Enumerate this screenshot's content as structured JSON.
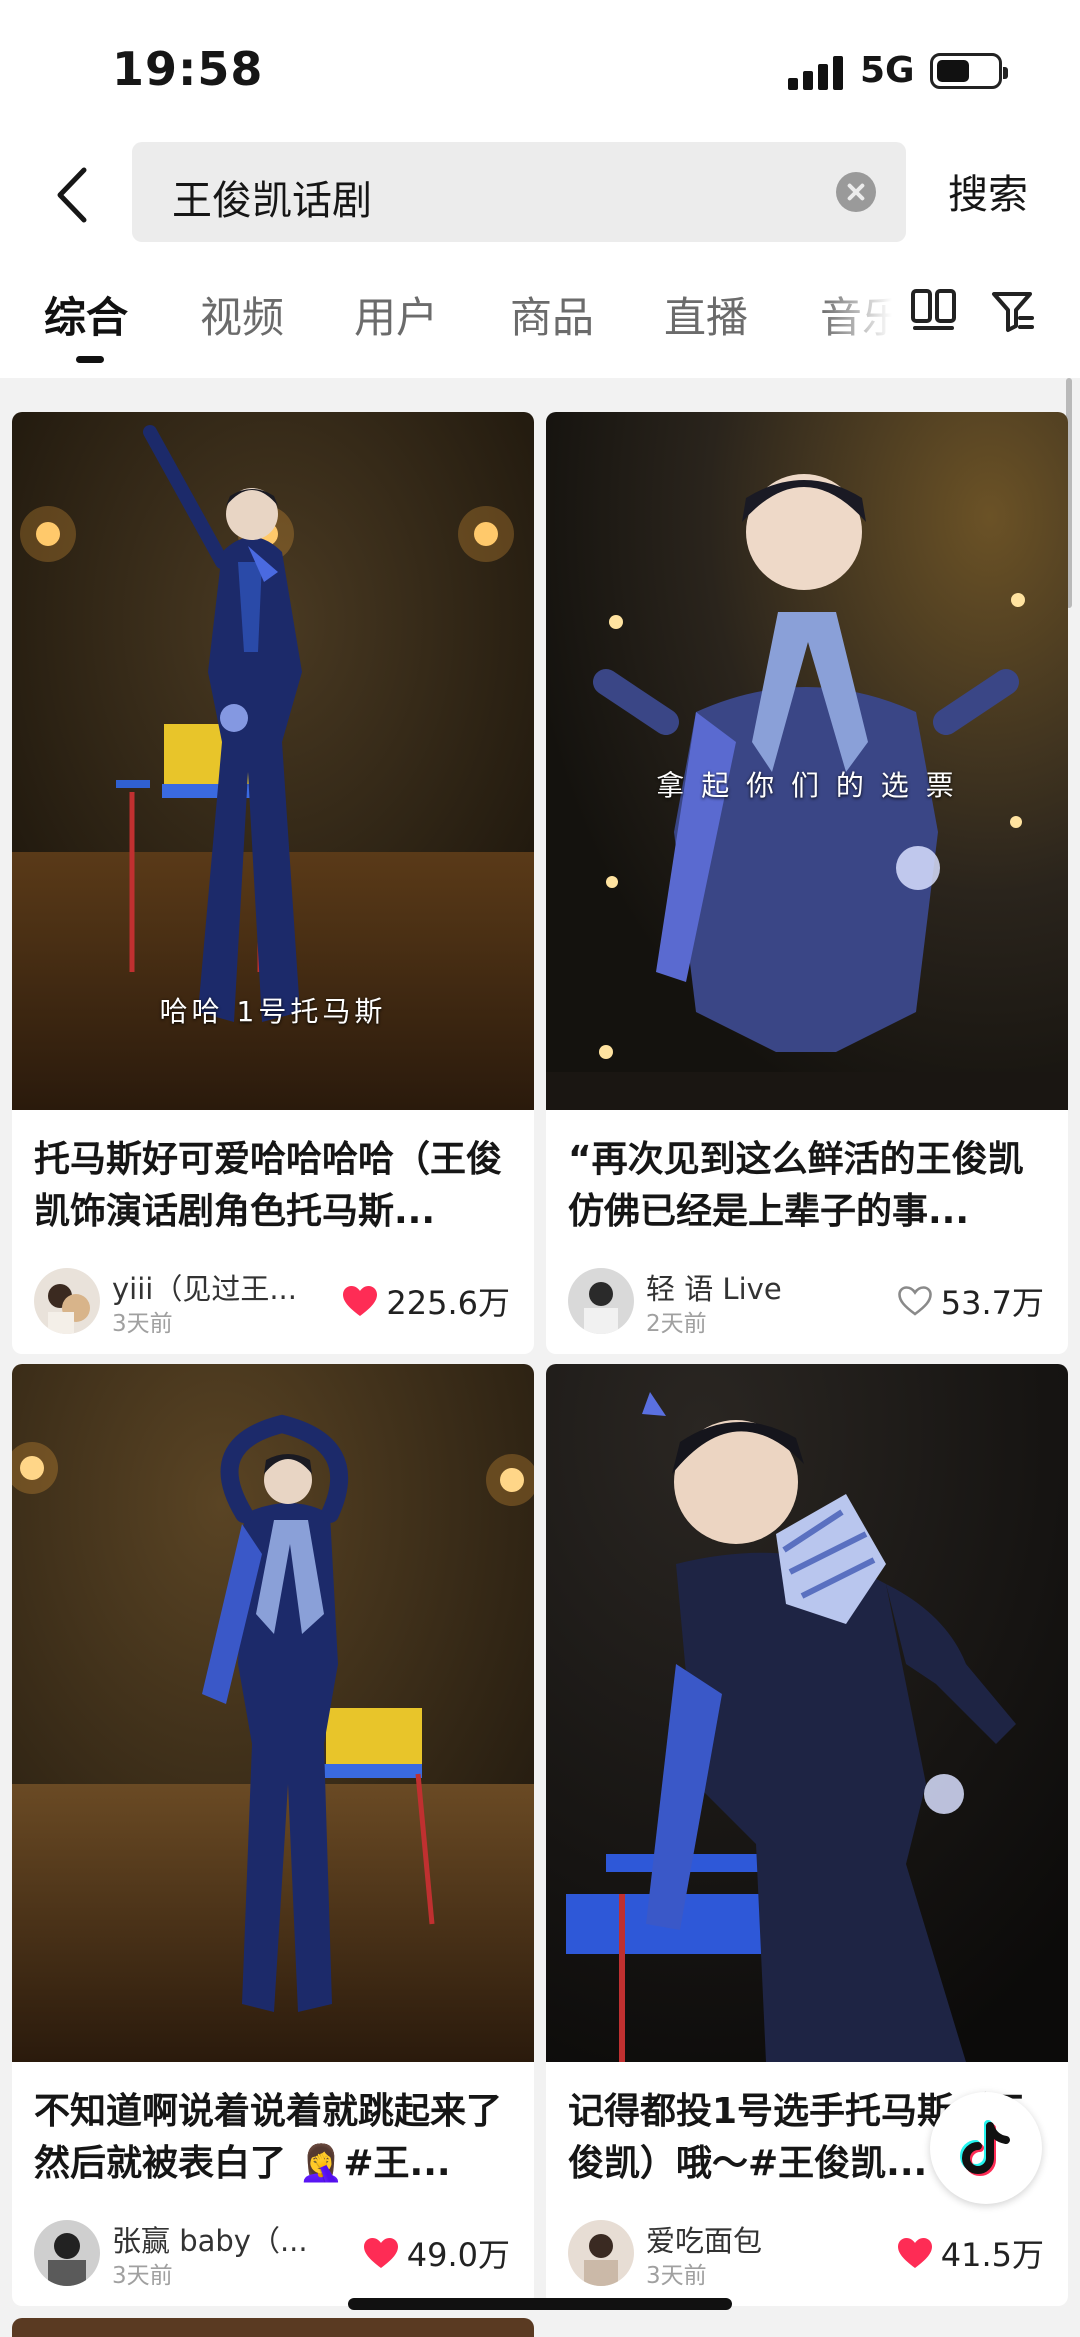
{
  "status_bar": {
    "time": "19:58",
    "network": "5G",
    "battery_level": 0.55
  },
  "search": {
    "query": "王俊凯话剧",
    "submit_label": "搜索"
  },
  "tabs": [
    {
      "label": "综合",
      "active": true
    },
    {
      "label": "视频",
      "active": false
    },
    {
      "label": "用户",
      "active": false
    },
    {
      "label": "商品",
      "active": false
    },
    {
      "label": "直播",
      "active": false
    },
    {
      "label": "音乐",
      "active": false
    }
  ],
  "icons": {
    "back": "chevron-left-icon",
    "clear": "clear-icon",
    "layout": "dual-column-layout-icon",
    "filter": "filter-icon",
    "like_filled": "heart-filled-icon",
    "like_outline": "heart-outline-icon",
    "app_logo": "tiktok-logo-icon"
  },
  "colors": {
    "accent_red": "#fe2c55",
    "background": "#f2f2f2",
    "card": "#ffffff"
  },
  "results": [
    {
      "caption": "哈哈 1号托马斯",
      "title": "托马斯好可爱哈哈哈哈（王俊凯饰演话剧角色托马斯...",
      "author": "yiii（见过王...",
      "time": "3天前",
      "likes": "225.6万",
      "liked": true
    },
    {
      "caption": "拿 起 你 们 的 选 票",
      "title": "“再次见到这么鲜活的王俊凯 仿佛已经是上辈子的事...",
      "author": "轻 语 Live",
      "time": "2天前",
      "likes": "53.7万",
      "liked": false
    },
    {
      "caption": "",
      "title": "不知道啊说着说着就跳起来了然后就被表白了 🤦‍♀️#王...",
      "author": "张赢 baby（...",
      "time": "3天前",
      "likes": "49.0万",
      "liked": true
    },
    {
      "caption": "",
      "title": "记得都投1号选手托马斯（王俊凯）哦～#王俊凯...",
      "author": "爱吃面包",
      "time": "3天前",
      "likes": "41.5万",
      "liked": true
    }
  ]
}
